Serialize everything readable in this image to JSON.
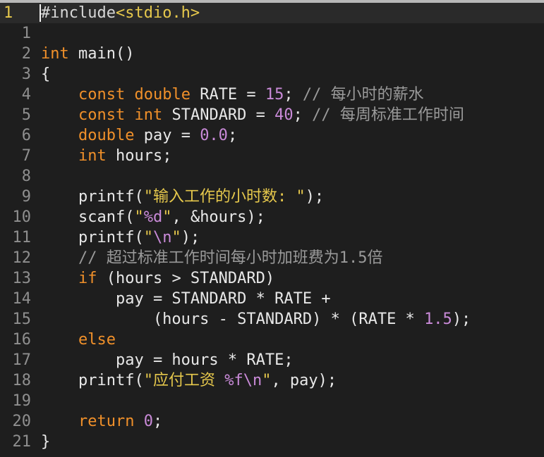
{
  "editor": {
    "current_line_number": "1",
    "lines": [
      {
        "n": "1",
        "cur": true,
        "tokens": [
          [
            "pp",
            "#include"
          ],
          [
            "hdr",
            "<stdio.h>"
          ]
        ]
      },
      {
        "n": "1",
        "tokens": []
      },
      {
        "n": "2",
        "tokens": [
          [
            "typ",
            "int"
          ],
          [
            "fn",
            " main()"
          ]
        ]
      },
      {
        "n": "3",
        "tokens": [
          [
            "fn",
            "{"
          ]
        ]
      },
      {
        "n": "4",
        "tokens": [
          [
            "fn",
            "    "
          ],
          [
            "kw",
            "const"
          ],
          [
            "fn",
            " "
          ],
          [
            "typ",
            "double"
          ],
          [
            "fn",
            " RATE = "
          ],
          [
            "numl",
            "15"
          ],
          [
            "fn",
            "; "
          ],
          [
            "com",
            "// 每小时的薪水"
          ]
        ]
      },
      {
        "n": "5",
        "tokens": [
          [
            "fn",
            "    "
          ],
          [
            "kw",
            "const"
          ],
          [
            "fn",
            " "
          ],
          [
            "typ",
            "int"
          ],
          [
            "fn",
            " STANDARD = "
          ],
          [
            "numl",
            "40"
          ],
          [
            "fn",
            "; "
          ],
          [
            "com",
            "// 每周标准工作时间"
          ]
        ]
      },
      {
        "n": "6",
        "tokens": [
          [
            "fn",
            "    "
          ],
          [
            "typ",
            "double"
          ],
          [
            "fn",
            " pay = "
          ],
          [
            "numl",
            "0.0"
          ],
          [
            "fn",
            ";"
          ]
        ]
      },
      {
        "n": "7",
        "tokens": [
          [
            "fn",
            "    "
          ],
          [
            "typ",
            "int"
          ],
          [
            "fn",
            " hours;"
          ]
        ]
      },
      {
        "n": "8",
        "tokens": []
      },
      {
        "n": "9",
        "tokens": [
          [
            "fn",
            "    printf("
          ],
          [
            "str",
            "\"输入工作的小时数: \""
          ],
          [
            "fn",
            ");"
          ]
        ]
      },
      {
        "n": "10",
        "tokens": [
          [
            "fn",
            "    scanf("
          ],
          [
            "str",
            "\""
          ],
          [
            "esc",
            "%d"
          ],
          [
            "str",
            "\""
          ],
          [
            "fn",
            ", &hours);"
          ]
        ]
      },
      {
        "n": "11",
        "tokens": [
          [
            "fn",
            "    printf("
          ],
          [
            "str",
            "\""
          ],
          [
            "esc",
            "\\n"
          ],
          [
            "str",
            "\""
          ],
          [
            "fn",
            ");"
          ]
        ]
      },
      {
        "n": "12",
        "tokens": [
          [
            "fn",
            "    "
          ],
          [
            "com",
            "// 超过标准工作时间每小时加班费为1.5倍"
          ]
        ]
      },
      {
        "n": "13",
        "tokens": [
          [
            "fn",
            "    "
          ],
          [
            "kw",
            "if"
          ],
          [
            "fn",
            " (hours > STANDARD)"
          ]
        ]
      },
      {
        "n": "14",
        "tokens": [
          [
            "fn",
            "        pay = STANDARD * RATE +"
          ]
        ]
      },
      {
        "n": "15",
        "tokens": [
          [
            "fn",
            "            (hours - STANDARD) * (RATE * "
          ],
          [
            "numl",
            "1.5"
          ],
          [
            "fn",
            ");"
          ]
        ]
      },
      {
        "n": "16",
        "tokens": [
          [
            "fn",
            "    "
          ],
          [
            "kw",
            "else"
          ]
        ]
      },
      {
        "n": "17",
        "tokens": [
          [
            "fn",
            "        pay = hours * RATE;"
          ]
        ]
      },
      {
        "n": "18",
        "tokens": [
          [
            "fn",
            "    printf("
          ],
          [
            "str",
            "\"应付工资 "
          ],
          [
            "esc",
            "%f\\n"
          ],
          [
            "str",
            "\""
          ],
          [
            "fn",
            ", pay);"
          ]
        ]
      },
      {
        "n": "19",
        "tokens": []
      },
      {
        "n": "20",
        "tokens": [
          [
            "fn",
            "    "
          ],
          [
            "kw",
            "return"
          ],
          [
            "fn",
            " "
          ],
          [
            "numl",
            "0"
          ],
          [
            "fn",
            ";"
          ]
        ]
      },
      {
        "n": "21",
        "tokens": [
          [
            "fn",
            "}"
          ]
        ]
      }
    ]
  }
}
